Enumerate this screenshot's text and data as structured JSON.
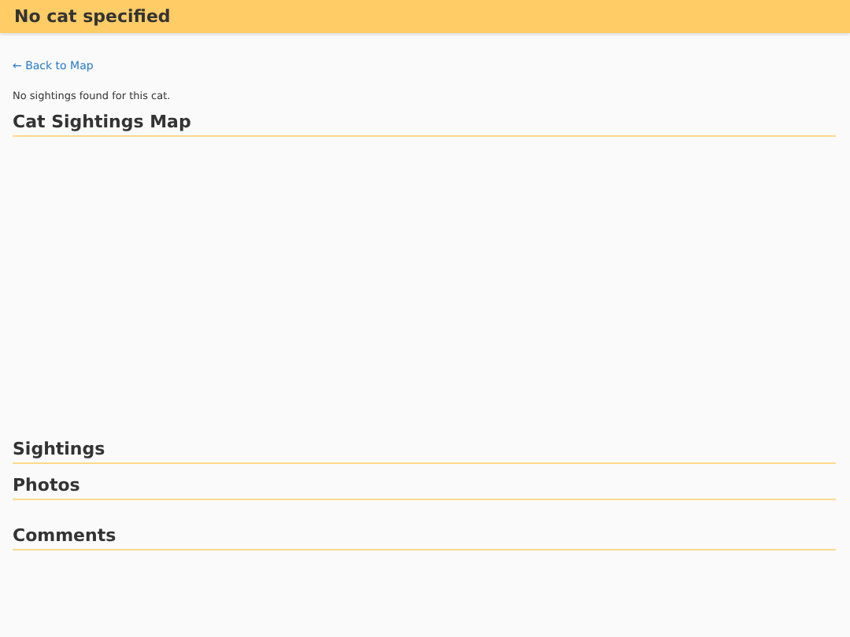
{
  "header": {
    "title": "No cat specified"
  },
  "back_link": "← Back to Map",
  "message": "No sightings found for this cat.",
  "sections": [
    {
      "kind": "map",
      "title": "Cat Sightings Map"
    },
    {
      "kind": "list",
      "title": "Sightings"
    },
    {
      "kind": "list",
      "title": "Photos"
    },
    {
      "kind": "comments",
      "title": "Comments"
    }
  ]
}
